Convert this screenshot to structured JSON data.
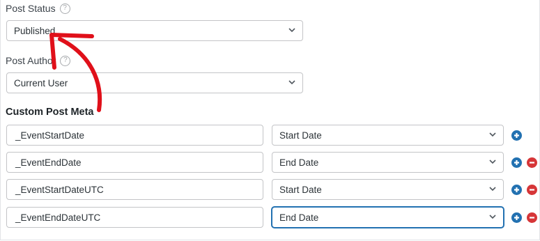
{
  "post_status": {
    "label": "Post Status",
    "help": "?",
    "value": "Published"
  },
  "post_author": {
    "label": "Post Author",
    "help": "?",
    "value": "Current User"
  },
  "custom_meta": {
    "title": "Custom Post Meta",
    "rows": [
      {
        "key": "_EventStartDate",
        "value": "Start Date"
      },
      {
        "key": "_EventEndDate",
        "value": "End Date"
      },
      {
        "key": "_EventStartDateUTC",
        "value": "Start Date"
      },
      {
        "key": "_EventEndDateUTC",
        "value": "End Date"
      }
    ]
  },
  "colors": {
    "add_button": "#2271b1",
    "remove_button": "#d63638",
    "annotation_arrow": "#e0101a"
  },
  "icons": {
    "help": "question-circle-icon",
    "dropdown": "chevron-down-icon",
    "add": "plus-circle-icon",
    "remove": "minus-circle-icon"
  }
}
